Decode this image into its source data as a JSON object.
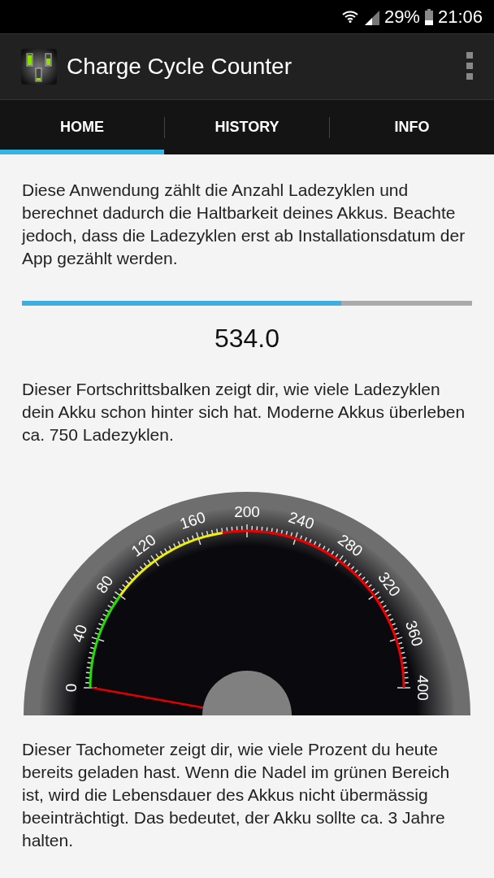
{
  "status_bar": {
    "battery": "29%",
    "time": "21:06"
  },
  "app_bar": {
    "title": "Charge Cycle Counter"
  },
  "tabs": [
    {
      "label": "HOME",
      "selected": true
    },
    {
      "label": "HISTORY",
      "selected": false
    },
    {
      "label": "INFO",
      "selected": false
    }
  ],
  "intro": "Diese Anwendung zählt die Anzahl Ladezyklen und berechnet dadurch die Haltbarkeit deines Akkus. Beachte jedoch, dass die Ladezyklen erst ab Installationsdatum der App gezählt werden.",
  "progress": {
    "level": 0.71,
    "value": "534.0"
  },
  "progress_note": "Dieser Fortschrittsbalken zeigt dir, wie viele Ladezyklen dein Akku schon hinter sich hat. Moderne Akkus überleben ca. 750 Ladezyklen.",
  "gauge": {
    "labels": [
      "0",
      "40",
      "80",
      "120",
      "160",
      "200",
      "240",
      "280",
      "320",
      "360",
      "400"
    ]
  },
  "gauge_note": "Dieser Tachometer zeigt dir, wie viele Prozent du heute bereits geladen hast. Wenn die Nadel im grünen Bereich ist, wird die Lebensdauer des Akkus nicht übermässig beeinträchtigt. Das bedeutet, der Akku sollte ca. 3 Jahre halten."
}
